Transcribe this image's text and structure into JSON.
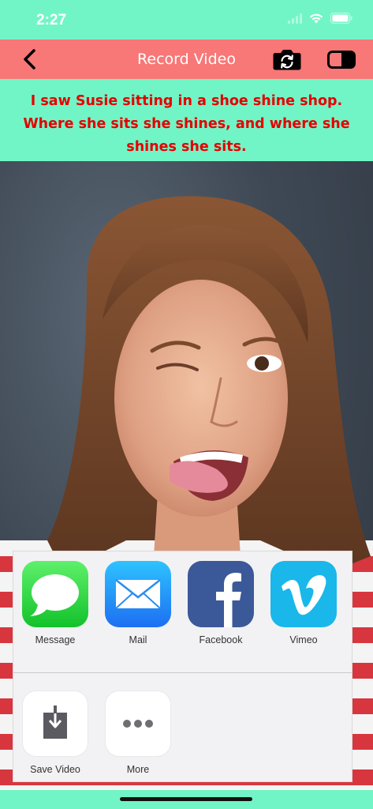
{
  "status_bar": {
    "time": "2:27"
  },
  "nav": {
    "title": "Record Video",
    "back_icon": "chevron-left-icon",
    "camera_icon": "camera-switch-icon",
    "toggle_icon": "toggle-icon"
  },
  "prompt": {
    "line1": "I saw Susie sitting in a shoe shine shop.",
    "line2": "Where she sits she shines, and where she",
    "line3": "shines she sits."
  },
  "share_sheet": {
    "row1": [
      {
        "label": "Message",
        "icon": "message-icon"
      },
      {
        "label": "Mail",
        "icon": "mail-icon"
      },
      {
        "label": "Facebook",
        "icon": "facebook-icon"
      },
      {
        "label": "Vimeo",
        "icon": "vimeo-icon"
      }
    ],
    "row2": [
      {
        "label": "Save Video",
        "icon": "save-video-icon"
      },
      {
        "label": "More",
        "icon": "more-icon"
      }
    ]
  },
  "colors": {
    "background": "#72f5c6",
    "nav_bar": "#f87777",
    "prompt_text": "#e60000"
  }
}
